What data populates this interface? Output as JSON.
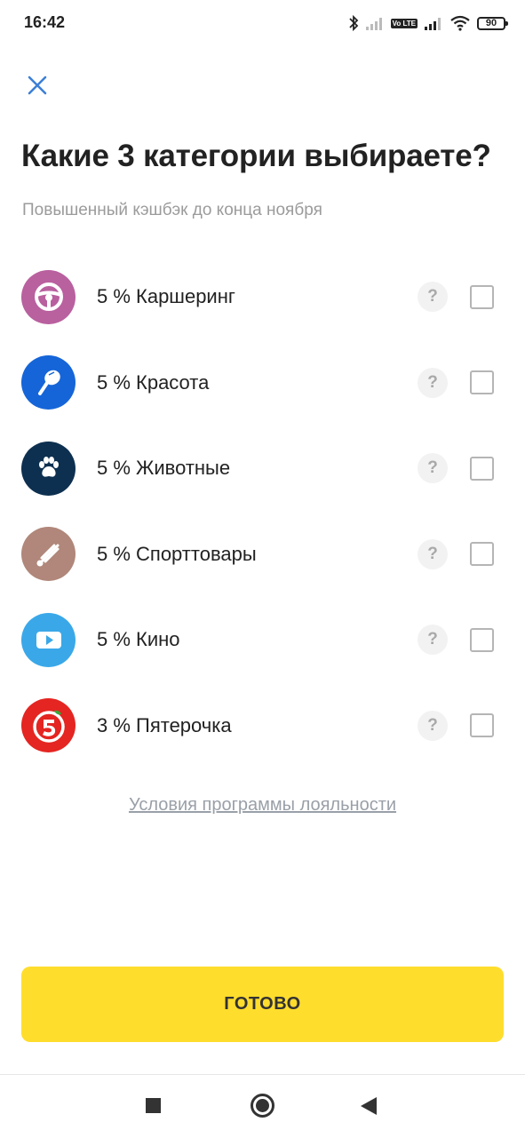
{
  "status_bar": {
    "time": "16:42",
    "volte": "Vo LTE",
    "battery": "90"
  },
  "header": {
    "close_icon": "close-icon",
    "title": "Какие 3 категории выбираете?",
    "subtitle": "Повышенный кэшбэк до конца ноября"
  },
  "categories": [
    {
      "label": "5 % Каршеринг",
      "icon": "steering-wheel-icon",
      "color": "#b9609f",
      "help": "?",
      "checked": false
    },
    {
      "label": "5 % Красота",
      "icon": "beauty-mirror-icon",
      "color": "#1565d8",
      "help": "?",
      "checked": false
    },
    {
      "label": "5 % Животные",
      "icon": "paw-icon",
      "color": "#0d3050",
      "help": "?",
      "checked": false
    },
    {
      "label": "5 % Спорттовары",
      "icon": "shuttlecock-icon",
      "color": "#b0877a",
      "help": "?",
      "checked": false
    },
    {
      "label": "5 % Кино",
      "icon": "play-icon",
      "color": "#3aa8e8",
      "help": "?",
      "checked": false
    },
    {
      "label": "3 % Пятерочка",
      "icon": "pyaterochka-logo-icon",
      "color": "#e42521",
      "help": "?",
      "checked": false
    }
  ],
  "loyalty_link": "Условия программы лояльности",
  "done_button": "ГОТОВО",
  "colors": {
    "accent_yellow": "#ffdd2d",
    "close_blue": "#3d7fd6"
  }
}
